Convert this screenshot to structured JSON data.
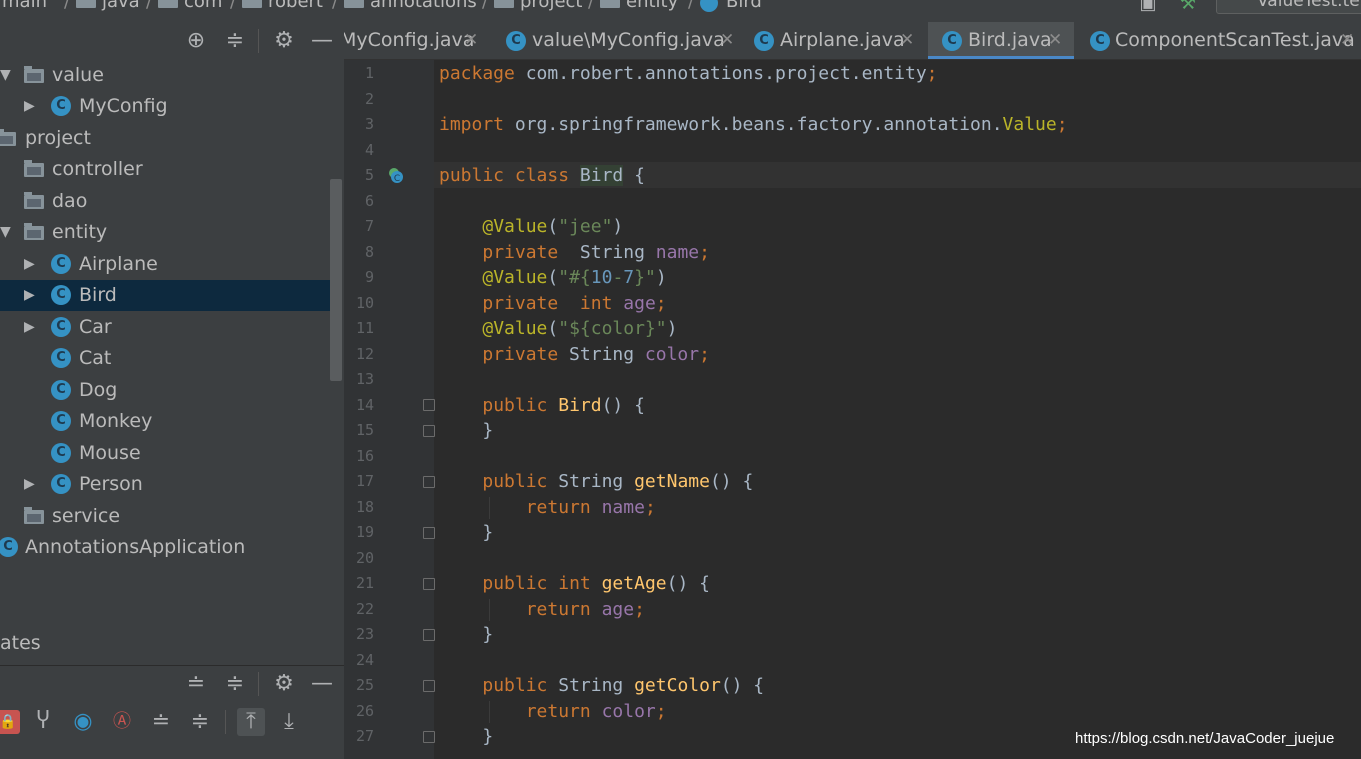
{
  "breadcrumb": [
    "main",
    "java",
    "com",
    "robert",
    "annotations",
    "project",
    "entity",
    "Bird"
  ],
  "run_config": "ValueTest.te",
  "project_tree": [
    {
      "label": "value",
      "kind": "folder",
      "expanded": true
    },
    {
      "label": "MyConfig",
      "kind": "class",
      "expandable": true
    },
    {
      "label": "project",
      "kind": "folder"
    },
    {
      "label": "controller",
      "kind": "folder"
    },
    {
      "label": "dao",
      "kind": "folder"
    },
    {
      "label": "entity",
      "kind": "folder",
      "expanded": true
    },
    {
      "label": "Airplane",
      "kind": "class",
      "expandable": true
    },
    {
      "label": "Bird",
      "kind": "class",
      "expandable": true,
      "selected": true
    },
    {
      "label": "Car",
      "kind": "class",
      "expandable": true
    },
    {
      "label": "Cat",
      "kind": "class"
    },
    {
      "label": "Dog",
      "kind": "class"
    },
    {
      "label": "Monkey",
      "kind": "class"
    },
    {
      "label": "Mouse",
      "kind": "class"
    },
    {
      "label": "Person",
      "kind": "class",
      "expandable": true
    },
    {
      "label": "service",
      "kind": "folder"
    },
    {
      "label": "AnnotationsApplication",
      "kind": "spring-app"
    }
  ],
  "structure_panel": {
    "title": "ates"
  },
  "tabs": [
    {
      "label": "MyConfig.java",
      "active": false
    },
    {
      "label": "value\\MyConfig.java",
      "active": false
    },
    {
      "label": "Airplane.java",
      "active": false
    },
    {
      "label": "Bird.java",
      "active": true
    },
    {
      "label": "ComponentScanTest.java",
      "active": false
    }
  ],
  "code": {
    "lines": [
      "package com.robert.annotations.project.entity;",
      "",
      "import org.springframework.beans.factory.annotation.Value;",
      "",
      "public class Bird {",
      "",
      "    @Value(\"jee\")",
      "    private  String name;",
      "    @Value(\"#{10-7}\")",
      "    private  int age;",
      "    @Value(\"${color}\")",
      "    private String color;",
      "",
      "    public Bird() {",
      "    }",
      "",
      "    public String getName() {",
      "        return name;",
      "    }",
      "",
      "    public int getAge() {",
      "        return age;",
      "    }",
      "",
      "    public String getColor() {",
      "        return color;",
      "    }"
    ],
    "caret_line": 5
  },
  "watermark": "https://blog.csdn.net/JavaCoder_juejue",
  "colors": {
    "keyword": "#cc7832",
    "string": "#6a8759",
    "annotation": "#bbb529",
    "field": "#9876aa",
    "method": "#ffc66d",
    "number": "#6897bb",
    "selection": "#0d293e",
    "tab_underline": "#4a88c7"
  }
}
